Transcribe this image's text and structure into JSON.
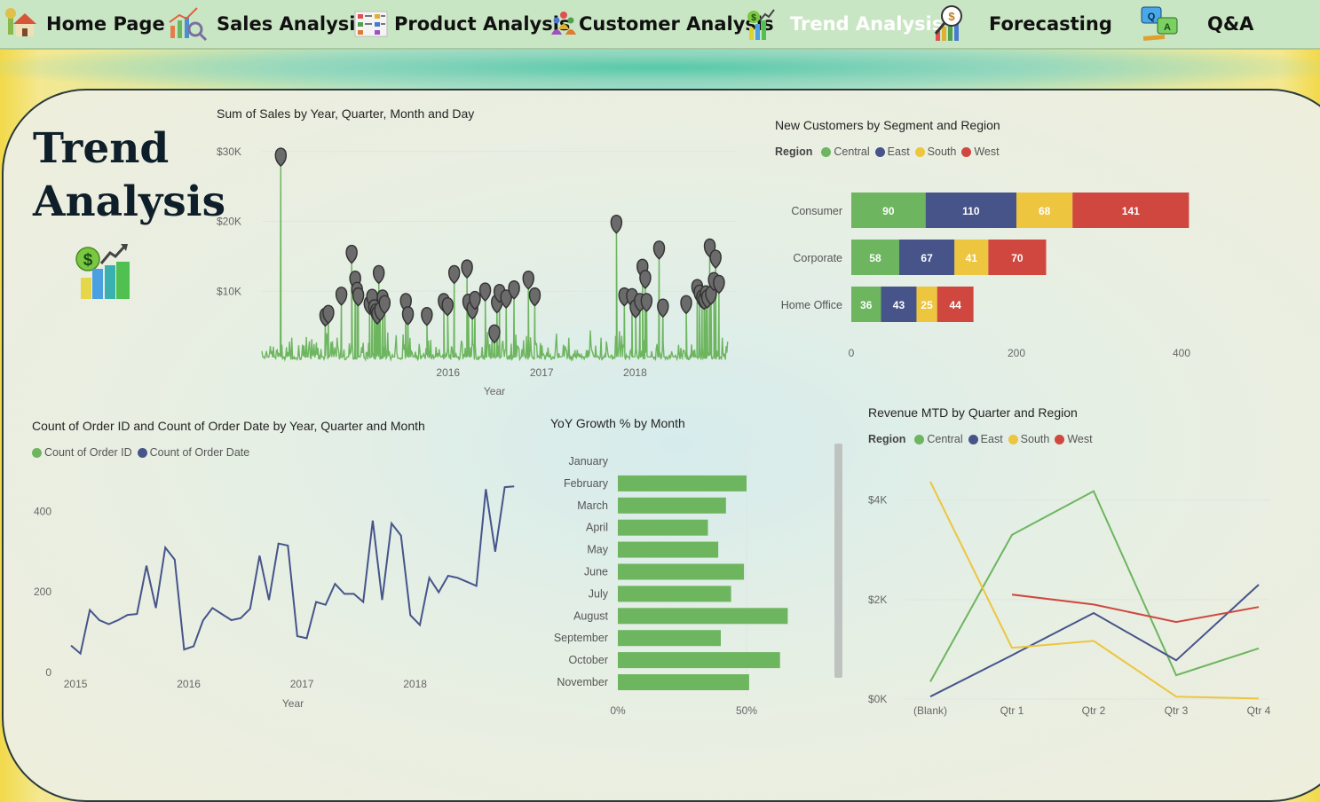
{
  "nav": {
    "items": [
      {
        "label": "Home Page",
        "icon": "house-icon"
      },
      {
        "label": "Sales Analysis",
        "icon": "chart-magnifier-icon"
      },
      {
        "label": "Product Analysis",
        "icon": "product-board-icon"
      },
      {
        "label": "Customer Analysis",
        "icon": "people-icon"
      },
      {
        "label": "Trend Analysis",
        "icon": "trend-chart-icon"
      },
      {
        "label": "Forecasting",
        "icon": "forecast-icon"
      },
      {
        "label": "Q&A",
        "icon": "qa-chat-icon"
      }
    ],
    "active": "Trend Analysis"
  },
  "page": {
    "title_line1": "Trend",
    "title_line2": "Analysis"
  },
  "colors": {
    "green": "#6db55f",
    "navy": "#46548a",
    "yellow": "#edc53e",
    "red": "#d0473f",
    "marker": "#6b6b6b"
  },
  "chart_data": [
    {
      "id": "sales",
      "type": "line",
      "title": "Sum of Sales by Year, Quarter, Month and Day",
      "xlabel": "Year",
      "ylabel": "",
      "y_ticks": [
        "$10K",
        "$20K",
        "$30K"
      ],
      "y_tick_values": [
        10000,
        20000,
        30000
      ],
      "x_ticks": [
        "2016",
        "2017",
        "2018"
      ],
      "x_tick_values": [
        "2016-01-01",
        "2017-01-01",
        "2018-01-01"
      ],
      "x_range": [
        "2014-01-03",
        "2018-12-30"
      ],
      "ylim": [
        0,
        32000
      ],
      "series_name": "Sum of Sales",
      "peaks": [
        {
          "x": "2014-03-18",
          "y": 29700
        },
        {
          "x": "2014-09-08",
          "y": 6800
        },
        {
          "x": "2014-09-20",
          "y": 7200
        },
        {
          "x": "2014-11-10",
          "y": 9800
        },
        {
          "x": "2014-12-20",
          "y": 15800
        },
        {
          "x": "2015-01-03",
          "y": 12100
        },
        {
          "x": "2015-01-10",
          "y": 10500
        },
        {
          "x": "2015-01-15",
          "y": 9700
        },
        {
          "x": "2015-02-28",
          "y": 8500
        },
        {
          "x": "2015-03-10",
          "y": 9500
        },
        {
          "x": "2015-03-18",
          "y": 8000
        },
        {
          "x": "2015-03-25",
          "y": 7400
        },
        {
          "x": "2015-03-30",
          "y": 7100
        },
        {
          "x": "2015-04-05",
          "y": 12900
        },
        {
          "x": "2015-04-10",
          "y": 7600
        },
        {
          "x": "2015-04-20",
          "y": 9400
        },
        {
          "x": "2015-04-28",
          "y": 8600
        },
        {
          "x": "2015-07-20",
          "y": 8900
        },
        {
          "x": "2015-07-28",
          "y": 7000
        },
        {
          "x": "2015-10-10",
          "y": 6900
        },
        {
          "x": "2015-12-15",
          "y": 8900
        },
        {
          "x": "2015-12-30",
          "y": 8300
        },
        {
          "x": "2016-01-25",
          "y": 12900
        },
        {
          "x": "2016-03-15",
          "y": 13700
        },
        {
          "x": "2016-03-20",
          "y": 8800
        },
        {
          "x": "2016-04-05",
          "y": 7800
        },
        {
          "x": "2016-04-15",
          "y": 9200
        },
        {
          "x": "2016-05-25",
          "y": 10400
        },
        {
          "x": "2016-06-30",
          "y": 4400
        },
        {
          "x": "2016-07-10",
          "y": 8700
        },
        {
          "x": "2016-07-20",
          "y": 10200
        },
        {
          "x": "2016-08-15",
          "y": 9400
        },
        {
          "x": "2016-09-15",
          "y": 10700
        },
        {
          "x": "2016-11-10",
          "y": 12100
        },
        {
          "x": "2016-12-05",
          "y": 9700
        },
        {
          "x": "2017-10-20",
          "y": 20100
        },
        {
          "x": "2017-11-20",
          "y": 9700
        },
        {
          "x": "2017-12-20",
          "y": 9600
        },
        {
          "x": "2018-01-03",
          "y": 8000
        },
        {
          "x": "2018-01-20",
          "y": 8900
        },
        {
          "x": "2018-01-30",
          "y": 13800
        },
        {
          "x": "2018-02-10",
          "y": 12200
        },
        {
          "x": "2018-02-15",
          "y": 8900
        },
        {
          "x": "2018-04-05",
          "y": 16400
        },
        {
          "x": "2018-04-20",
          "y": 8100
        },
        {
          "x": "2018-07-20",
          "y": 8600
        },
        {
          "x": "2018-09-01",
          "y": 10900
        },
        {
          "x": "2018-09-10",
          "y": 10100
        },
        {
          "x": "2018-09-20",
          "y": 9400
        },
        {
          "x": "2018-09-28",
          "y": 9200
        },
        {
          "x": "2018-10-05",
          "y": 10000
        },
        {
          "x": "2018-10-10",
          "y": 9400
        },
        {
          "x": "2018-10-20",
          "y": 16700
        },
        {
          "x": "2018-10-25",
          "y": 9900
        },
        {
          "x": "2018-11-05",
          "y": 11900
        },
        {
          "x": "2018-11-12",
          "y": 15100
        },
        {
          "x": "2018-11-25",
          "y": 11500
        }
      ]
    },
    {
      "id": "customers",
      "type": "bar",
      "orientation": "horizontal-stacked",
      "title": "New Customers by Segment and Region",
      "legend_title": "Region",
      "categories": [
        "Consumer",
        "Corporate",
        "Home Office"
      ],
      "series": [
        {
          "name": "Central",
          "values": [
            90,
            58,
            36
          ],
          "color": "#6db55f"
        },
        {
          "name": "East",
          "values": [
            110,
            67,
            43
          ],
          "color": "#46548a"
        },
        {
          "name": "South",
          "values": [
            68,
            41,
            25
          ],
          "color": "#edc53e"
        },
        {
          "name": "West",
          "values": [
            141,
            70,
            44
          ],
          "color": "#d0473f"
        }
      ],
      "x_ticks": [
        0,
        200,
        400
      ],
      "xlim": [
        0,
        400
      ]
    },
    {
      "id": "orders",
      "type": "line",
      "title": "Count of Order ID and Count of Order Date by Year, Quarter and Month",
      "xlabel": "Year",
      "legend": [
        "Count of Order ID",
        "Count of Order Date"
      ],
      "legend_colors": [
        "#6db55f",
        "#46548a"
      ],
      "y_ticks": [
        0,
        200,
        400
      ],
      "ylim": [
        0,
        480
      ],
      "x_ticks": [
        "2015",
        "2016",
        "2017",
        "2018"
      ],
      "x_tick_values": [
        2015,
        2016,
        2017,
        2018
      ],
      "x_range": [
        2014.96,
        2019.0
      ],
      "x_step": 0.0833,
      "series": [
        {
          "name": "Count of Order Date",
          "color": "#46548a",
          "values": [
            67,
            47,
            155,
            130,
            120,
            130,
            143,
            145,
            265,
            160,
            310,
            280,
            57,
            65,
            129,
            160,
            145,
            130,
            135,
            158,
            290,
            180,
            320,
            315,
            90,
            85,
            175,
            168,
            220,
            195,
            195,
            175,
            377,
            180,
            370,
            340,
            142,
            118,
            235,
            199,
            240,
            235,
            225,
            215,
            455,
            300,
            460,
            462
          ]
        }
      ]
    },
    {
      "id": "yoy",
      "type": "bar",
      "orientation": "horizontal",
      "title": "YoY Growth % by Month",
      "categories": [
        "January",
        "February",
        "March",
        "April",
        "May",
        "June",
        "July",
        "August",
        "September",
        "October",
        "November"
      ],
      "values": [
        0,
        50,
        42,
        35,
        39,
        49,
        44,
        66,
        40,
        63,
        51
      ],
      "unit": "%",
      "x_ticks": [
        "0%",
        "50%"
      ],
      "x_tick_values": [
        0,
        50
      ],
      "xlim": [
        0,
        70
      ]
    },
    {
      "id": "revenue",
      "type": "line",
      "title": "Revenue MTD by Quarter and Region",
      "legend_title": "Region",
      "categories": [
        "(Blank)",
        "Qtr 1",
        "Qtr 2",
        "Qtr 3",
        "Qtr 4"
      ],
      "y_ticks": [
        "$0K",
        "$2K",
        "$4K"
      ],
      "y_tick_values": [
        0,
        2000,
        4000
      ],
      "ylim": [
        0,
        4600
      ],
      "series": [
        {
          "name": "Central",
          "color": "#6db55f",
          "values": [
            350,
            3300,
            4180,
            480,
            1020
          ]
        },
        {
          "name": "East",
          "color": "#46548a",
          "values": [
            50,
            880,
            1730,
            780,
            2300
          ]
        },
        {
          "name": "South",
          "color": "#edc53e",
          "values": [
            4370,
            1030,
            1170,
            50,
            10
          ]
        },
        {
          "name": "West",
          "color": "#d0473f",
          "values": [
            null,
            2100,
            1900,
            1550,
            1850
          ]
        }
      ]
    }
  ]
}
